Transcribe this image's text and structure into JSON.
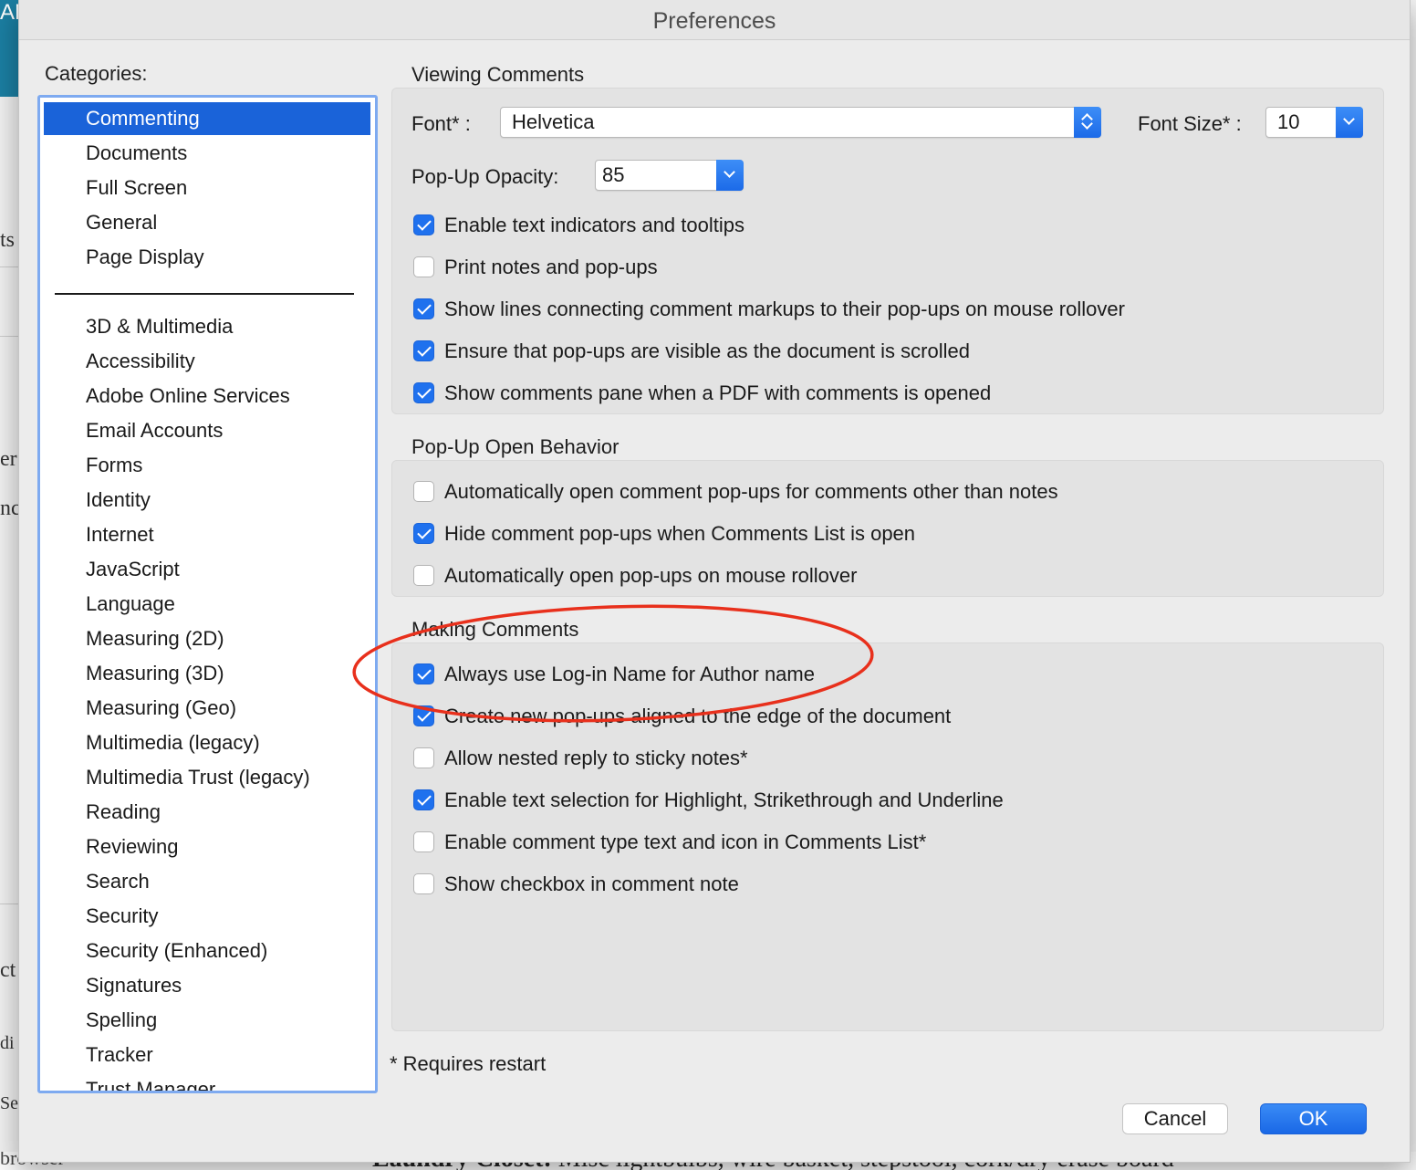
{
  "background": {
    "corner_text": "AM",
    "left_fragments": [
      "ts",
      "er",
      "nc",
      "ct",
      "di",
      "Se"
    ],
    "bottom_left_text": "browser",
    "bottom_text_bold": "Laundry Closet:",
    "bottom_text": " Misc lightbulbs, wire basket, stepstool, cork/dry erase board"
  },
  "dialog": {
    "title": "Preferences",
    "categories_label": "Categories:",
    "categories_top": [
      "Commenting",
      "Documents",
      "Full Screen",
      "General",
      "Page Display"
    ],
    "categories_more": [
      "3D & Multimedia",
      "Accessibility",
      "Adobe Online Services",
      "Email Accounts",
      "Forms",
      "Identity",
      "Internet",
      "JavaScript",
      "Language",
      "Measuring (2D)",
      "Measuring (3D)",
      "Measuring (Geo)",
      "Multimedia (legacy)",
      "Multimedia Trust (legacy)",
      "Reading",
      "Reviewing",
      "Search",
      "Security",
      "Security (Enhanced)",
      "Signatures",
      "Spelling",
      "Tracker",
      "Trust Manager"
    ],
    "selected_category": "Commenting",
    "viewing": {
      "title": "Viewing Comments",
      "font_label": "Font* :",
      "font_value": "Helvetica",
      "font_size_label": "Font Size* :",
      "font_size_value": "10",
      "opacity_label": "Pop-Up Opacity:",
      "opacity_value": "85",
      "options": [
        {
          "label": "Enable text indicators and tooltips",
          "checked": true
        },
        {
          "label": "Print notes and pop-ups",
          "checked": false
        },
        {
          "label": "Show lines connecting comment markups to their pop-ups on mouse rollover",
          "checked": true
        },
        {
          "label": "Ensure that pop-ups are visible as the document is scrolled",
          "checked": true
        },
        {
          "label": "Show comments pane when a PDF with comments is opened",
          "checked": true
        }
      ]
    },
    "popup": {
      "title": "Pop-Up Open Behavior",
      "options": [
        {
          "label": "Automatically open comment pop-ups for comments other than notes",
          "checked": false
        },
        {
          "label": "Hide comment pop-ups when Comments List is open",
          "checked": true
        },
        {
          "label": "Automatically open pop-ups on mouse rollover",
          "checked": false
        }
      ]
    },
    "making": {
      "title": "Making Comments",
      "options": [
        {
          "label": "Always use Log-in Name for Author name",
          "checked": true
        },
        {
          "label": "Create new pop-ups aligned to the edge of the document",
          "checked": true
        },
        {
          "label": "Allow nested reply to sticky notes*",
          "checked": false
        },
        {
          "label": "Enable text selection for Highlight, Strikethrough and Underline",
          "checked": true
        },
        {
          "label": "Enable comment type text and icon in Comments List*",
          "checked": false
        },
        {
          "label": "Show checkbox in comment note",
          "checked": false
        }
      ]
    },
    "requires_restart": "* Requires restart",
    "cancel_label": "Cancel",
    "ok_label": "OK"
  },
  "colors": {
    "accent": "#1a63d9",
    "annotation": "#e8301c"
  }
}
